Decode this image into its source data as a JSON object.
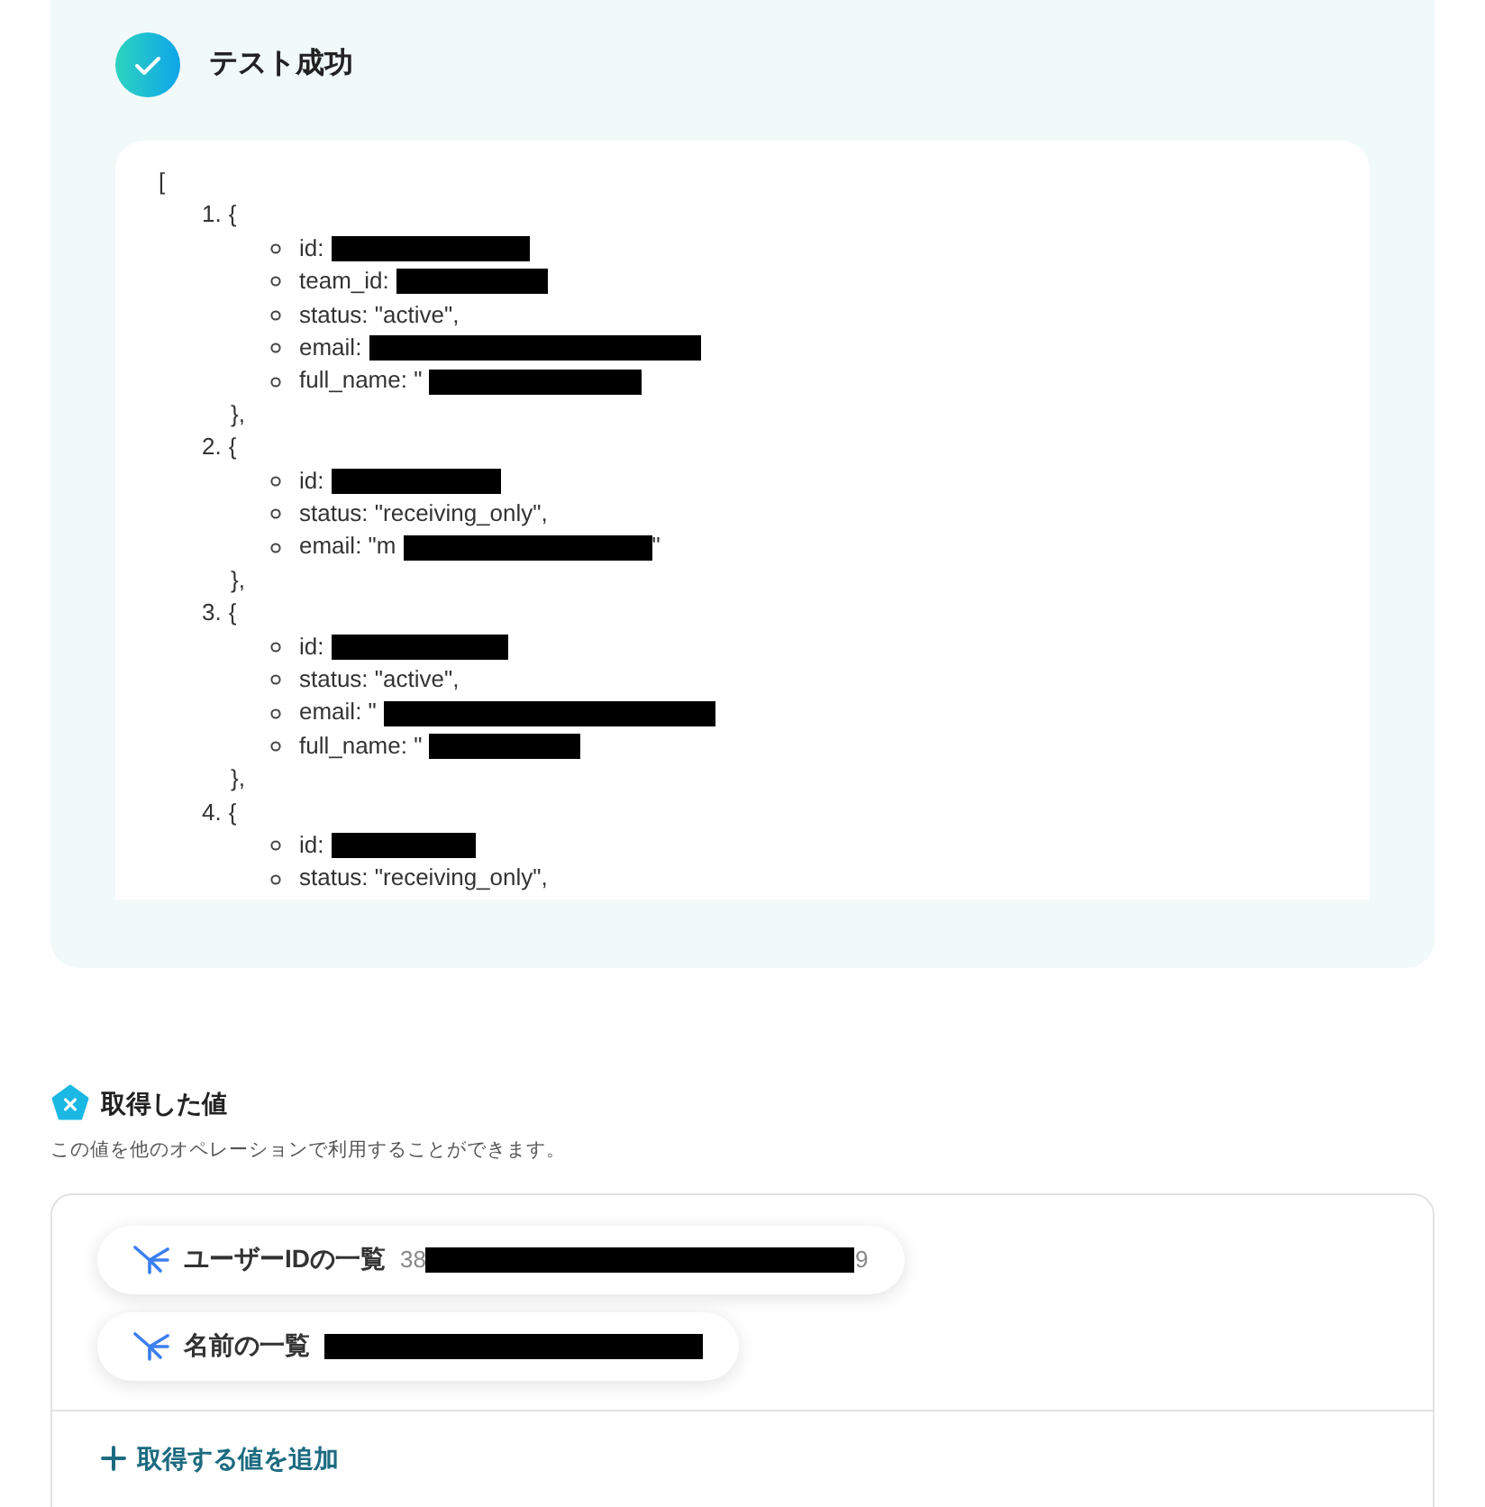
{
  "test_result": {
    "title": "テスト成功"
  },
  "output": {
    "open_bracket": "[",
    "items": [
      {
        "number": "1.",
        "open": "{",
        "close": "},",
        "fields": [
          {
            "text": "id:",
            "redacted": true
          },
          {
            "text": "team_id:",
            "redacted": true
          },
          {
            "text": "status: \"active\","
          },
          {
            "text": "email:",
            "redacted": true
          },
          {
            "text": "full_name: \"",
            "redacted": true
          }
        ]
      },
      {
        "number": "2.",
        "open": "{",
        "close": "},",
        "fields": [
          {
            "text": "id:",
            "redacted": true
          },
          {
            "text": "status: \"receiving_only\","
          },
          {
            "text": "email: \"m",
            "redacted": true,
            "after": "\""
          }
        ]
      },
      {
        "number": "3.",
        "open": "{",
        "close": "},",
        "fields": [
          {
            "text": "id:",
            "redacted": true
          },
          {
            "text": "status: \"active\","
          },
          {
            "text": "email: \"",
            "redacted": true
          },
          {
            "text": "full_name: \"",
            "redacted": true
          }
        ]
      },
      {
        "number": "4.",
        "open": "{",
        "fields": [
          {
            "text": "id:",
            "redacted": true
          },
          {
            "text": "status: \"receiving_only\","
          }
        ]
      }
    ]
  },
  "values_section": {
    "title": "取得した値",
    "description": "この値を他のオペレーションで利用することができます。",
    "values": [
      {
        "label": "ユーザーIDの一覧",
        "preview": "38",
        "redacted": true,
        "after": "9"
      },
      {
        "label": "名前の一覧",
        "redacted": true
      }
    ],
    "add_button": "取得する値を追加"
  }
}
